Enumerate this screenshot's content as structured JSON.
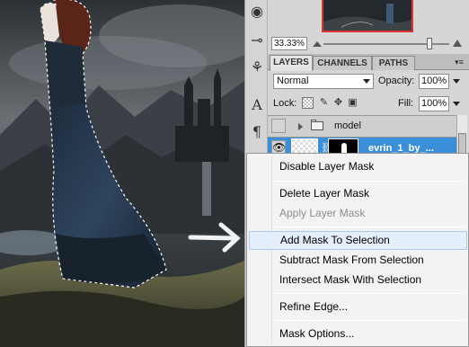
{
  "navigator": {
    "zoom_value": "33.33%",
    "zoom_slider_level": 0.86
  },
  "panel_tabs": [
    "LAYERS",
    "CHANNELS",
    "PATHS"
  ],
  "layers_panel": {
    "blend_mode": "Normal",
    "opacity_label": "Opacity:",
    "opacity_value": "100%",
    "lock_label": "Lock:",
    "fill_label": "Fill:",
    "fill_value": "100%",
    "layers": [
      {
        "name": "model",
        "type": "group"
      },
      {
        "name": "evrin_1_by_...",
        "type": "layer-with-mask",
        "selected": true
      }
    ]
  },
  "tool_icons": [
    "eye-ring-icon",
    "measure-icon",
    "brush-pair-icon",
    "type-icon",
    "paragraph-icon"
  ],
  "context_menu": {
    "items": [
      {
        "label": "Disable Layer Mask",
        "enabled": true
      },
      {
        "label": "Delete Layer Mask",
        "enabled": true
      },
      {
        "label": "Apply Layer Mask",
        "enabled": false
      },
      {
        "label": "Add Mask To Selection",
        "enabled": true,
        "hovered": true
      },
      {
        "label": "Subtract Mask From Selection",
        "enabled": true
      },
      {
        "label": "Intersect Mask With Selection",
        "enabled": true
      },
      {
        "label": "Refine Edge...",
        "enabled": true
      },
      {
        "label": "Mask Options...",
        "enabled": true
      }
    ]
  },
  "colors": {
    "selected_layer": "#3b8fd8",
    "menu_hover": "#e5eefb",
    "navigator_frame": "#dd3333",
    "arrow_annotation": "#f2f2f2"
  }
}
